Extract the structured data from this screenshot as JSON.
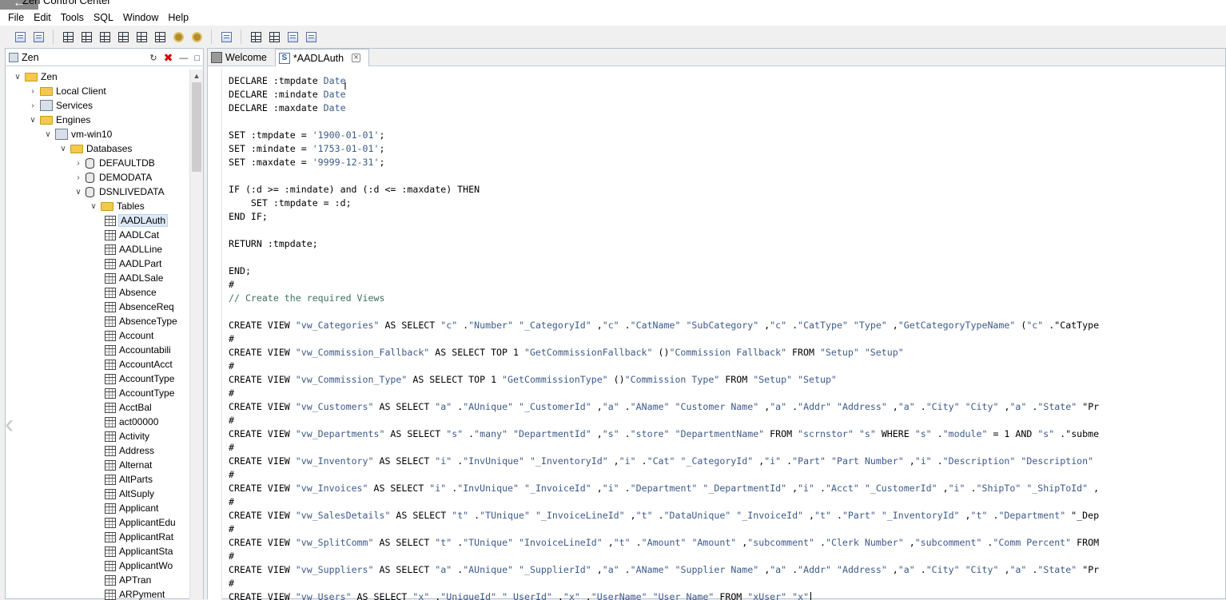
{
  "app": {
    "title": "Zen Control Center"
  },
  "menu": [
    "File",
    "Edit",
    "Tools",
    "SQL",
    "Window",
    "Help"
  ],
  "toolbar": {
    "icons": [
      "save-icon",
      "print-icon",
      "new-table-icon",
      "new-view-icon",
      "new-procedure-icon",
      "new-trigger-icon",
      "new-function-icon",
      "new-user-icon",
      "new-group-icon",
      "security-icon",
      "sql-document-icon",
      "grid-icon",
      "table-designer-icon",
      "import-icon",
      "export-icon"
    ]
  },
  "explorer": {
    "tab_label": "Zen",
    "tree": [
      {
        "label": "Zen",
        "depth": 0,
        "icon": "folder",
        "state": "expanded"
      },
      {
        "label": "Local Client",
        "depth": 1,
        "icon": "folder",
        "state": "collapsed"
      },
      {
        "label": "Services",
        "depth": 1,
        "icon": "gear",
        "state": "collapsed"
      },
      {
        "label": "Engines",
        "depth": 1,
        "icon": "folder",
        "state": "expanded"
      },
      {
        "label": "vm-win10",
        "depth": 2,
        "icon": "computer",
        "state": "expanded"
      },
      {
        "label": "Databases",
        "depth": 3,
        "icon": "folder",
        "state": "expanded"
      },
      {
        "label": "DEFAULTDB",
        "depth": 4,
        "icon": "database",
        "state": "collapsed"
      },
      {
        "label": "DEMODATA",
        "depth": 4,
        "icon": "database",
        "state": "collapsed"
      },
      {
        "label": "DSNLIVEDATA",
        "depth": 4,
        "icon": "database",
        "state": "expanded"
      },
      {
        "label": "Tables",
        "depth": 5,
        "icon": "folder",
        "state": "expanded"
      },
      {
        "label": "AADLAuth",
        "depth": 6,
        "icon": "table",
        "state": "leaf",
        "selected": true
      },
      {
        "label": "AADLCat",
        "depth": 6,
        "icon": "table",
        "state": "leaf"
      },
      {
        "label": "AADLLine",
        "depth": 6,
        "icon": "table",
        "state": "leaf"
      },
      {
        "label": "AADLPart",
        "depth": 6,
        "icon": "table",
        "state": "leaf"
      },
      {
        "label": "AADLSale",
        "depth": 6,
        "icon": "table",
        "state": "leaf"
      },
      {
        "label": "Absence",
        "depth": 6,
        "icon": "table",
        "state": "leaf"
      },
      {
        "label": "AbsenceReq",
        "depth": 6,
        "icon": "table",
        "state": "leaf"
      },
      {
        "label": "AbsenceType",
        "depth": 6,
        "icon": "table",
        "state": "leaf"
      },
      {
        "label": "Account",
        "depth": 6,
        "icon": "table",
        "state": "leaf"
      },
      {
        "label": "Accountabili",
        "depth": 6,
        "icon": "table",
        "state": "leaf"
      },
      {
        "label": "AccountAcct",
        "depth": 6,
        "icon": "table",
        "state": "leaf"
      },
      {
        "label": "AccountType",
        "depth": 6,
        "icon": "table",
        "state": "leaf"
      },
      {
        "label": "AccountType",
        "depth": 6,
        "icon": "table",
        "state": "leaf"
      },
      {
        "label": "AcctBal",
        "depth": 6,
        "icon": "table",
        "state": "leaf"
      },
      {
        "label": "act00000",
        "depth": 6,
        "icon": "table",
        "state": "leaf"
      },
      {
        "label": "Activity",
        "depth": 6,
        "icon": "table",
        "state": "leaf"
      },
      {
        "label": "Address",
        "depth": 6,
        "icon": "table",
        "state": "leaf"
      },
      {
        "label": "Alternat",
        "depth": 6,
        "icon": "table",
        "state": "leaf"
      },
      {
        "label": "AltParts",
        "depth": 6,
        "icon": "table",
        "state": "leaf"
      },
      {
        "label": "AltSuply",
        "depth": 6,
        "icon": "table",
        "state": "leaf"
      },
      {
        "label": "Applicant",
        "depth": 6,
        "icon": "table",
        "state": "leaf"
      },
      {
        "label": "ApplicantEdu",
        "depth": 6,
        "icon": "table",
        "state": "leaf"
      },
      {
        "label": "ApplicantRat",
        "depth": 6,
        "icon": "table",
        "state": "leaf"
      },
      {
        "label": "ApplicantSta",
        "depth": 6,
        "icon": "table",
        "state": "leaf"
      },
      {
        "label": "ApplicantWo",
        "depth": 6,
        "icon": "table",
        "state": "leaf"
      },
      {
        "label": "APTran",
        "depth": 6,
        "icon": "table",
        "state": "leaf"
      },
      {
        "label": "ARPyment",
        "depth": 6,
        "icon": "table",
        "state": "leaf"
      }
    ]
  },
  "editor": {
    "tabs": [
      {
        "label": "Welcome",
        "active": false
      },
      {
        "label": "*AADLAuth",
        "active": true
      }
    ],
    "lines": [
      "DECLARE :tmpdate Date",
      "DECLARE :mindate Date",
      "DECLARE :maxdate Date",
      "",
      "SET :tmpdate = '1900-01-01';",
      "SET :mindate = '1753-01-01';",
      "SET :maxdate = '9999-12-31';",
      "",
      "IF (:d >= :mindate) and (:d <= :maxdate) THEN",
      "    SET :tmpdate = :d;",
      "END IF;",
      "",
      "RETURN :tmpdate;",
      "",
      "END;",
      "#",
      "// Create the required Views",
      "",
      "CREATE VIEW \"vw_Categories\" AS SELECT \"c\" .\"Number\" \"_CategoryId\" ,\"c\" .\"CatName\" \"SubCategory\" ,\"c\" .\"CatType\" \"Type\" ,\"GetCategoryTypeName\" (\"c\" .\"CatType",
      "#",
      "CREATE VIEW \"vw_Commission_Fallback\" AS SELECT TOP 1 \"GetCommissionFallback\" ()\"Commission Fallback\" FROM \"Setup\" \"Setup\"",
      "#",
      "CREATE VIEW \"vw_Commission_Type\" AS SELECT TOP 1 \"GetCommissionType\" ()\"Commission Type\" FROM \"Setup\" \"Setup\"",
      "#",
      "CREATE VIEW \"vw_Customers\" AS SELECT \"a\" .\"AUnique\" \"_CustomerId\" ,\"a\" .\"AName\" \"Customer Name\" ,\"a\" .\"Addr\" \"Address\" ,\"a\" .\"City\" \"City\" ,\"a\" .\"State\" \"Pr",
      "#",
      "CREATE VIEW \"vw_Departments\" AS SELECT \"s\" .\"many\" \"DepartmentId\" ,\"s\" .\"store\" \"DepartmentName\" FROM \"scrnstor\" \"s\" WHERE \"s\" .\"module\" = 1 AND \"s\" .\"subme",
      "#",
      "CREATE VIEW \"vw_Inventory\" AS SELECT \"i\" .\"InvUnique\" \"_InventoryId\" ,\"i\" .\"Cat\" \"_CategoryId\" ,\"i\" .\"Part\" \"Part Number\" ,\"i\" .\"Description\" \"Description\"",
      "#",
      "CREATE VIEW \"vw_Invoices\" AS SELECT \"i\" .\"InvUnique\" \"_InvoiceId\" ,\"i\" .\"Department\" \"_DepartmentId\" ,\"i\" .\"Acct\" \"_CustomerId\" ,\"i\" .\"ShipTo\" \"_ShipToId\" ,",
      "#",
      "CREATE VIEW \"vw_SalesDetails\" AS SELECT \"t\" .\"TUnique\" \"_InvoiceLineId\" ,\"t\" .\"DataUnique\" \"_InvoiceId\" ,\"t\" .\"Part\" \"_InventoryId\" ,\"t\" .\"Department\" \"_Dep",
      "#",
      "CREATE VIEW \"vw_SplitComm\" AS SELECT \"t\" .\"TUnique\" \"InvoiceLineId\" ,\"t\" .\"Amount\" \"Amount\" ,\"subcomment\" .\"Clerk Number\" ,\"subcomment\" .\"Comm Percent\" FROM",
      "#",
      "CREATE VIEW \"vw_Suppliers\" AS SELECT \"a\" .\"AUnique\" \"_SupplierId\" ,\"a\" .\"AName\" \"Supplier Name\" ,\"a\" .\"Addr\" \"Address\" ,\"a\" .\"City\" \"City\" ,\"a\" .\"State\" \"Pr",
      "#",
      "CREATE VIEW \"vw_Users\" AS SELECT \"x\" .\"UniqueId\" \"_UserId\" ,\"x\" .\"UserName\" \"User Name\" FROM \"xUser\" \"x\""
    ]
  },
  "colors": {
    "keyword": "#000000",
    "string": "#3d5a8a",
    "comment": "#3f6f5f",
    "selection": "#dde8f6"
  }
}
